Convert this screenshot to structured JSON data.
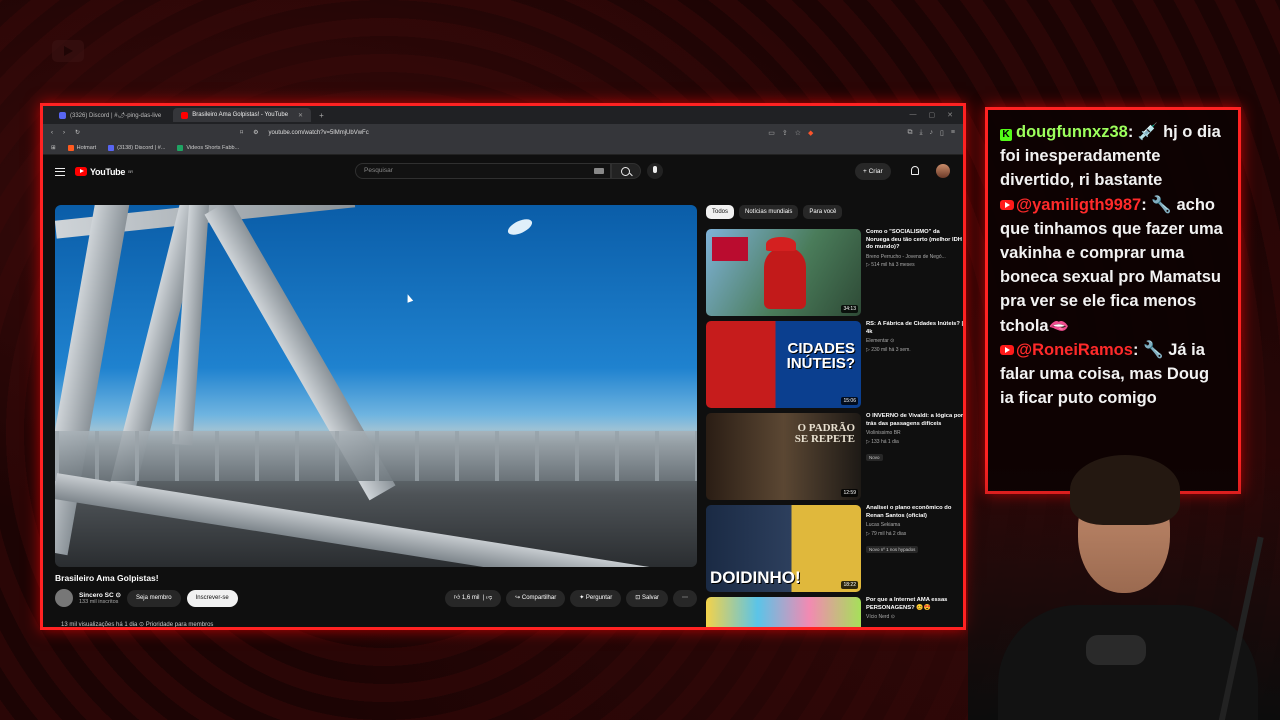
{
  "browser": {
    "tabs": [
      {
        "label": "(3326) Discord | #🌶-ping-das-live"
      },
      {
        "label": "Brasileiro Ama Golpistas! - YouTube"
      }
    ],
    "url": "youtube.com/watch?v=5lMmjUbVwFc",
    "bookmarks": [
      {
        "label": "Hotmart",
        "color": "#ff5a1f"
      },
      {
        "label": "(3138) Discord | #...",
        "color": "#5865f2"
      },
      {
        "label": "Videos Shorts Fabb...",
        "color": "#1fa463"
      }
    ]
  },
  "youtube": {
    "logo": "YouTube",
    "logo_country": "BR",
    "search_placeholder": "Pesquisar",
    "create_label": "+ Criar",
    "video": {
      "title": "Brasileiro Ama Golpistas!",
      "channel": "Sincero SC",
      "subscribers": "133 mil inscritos",
      "join_label": "Seja membro",
      "subscribe_label": "Inscrever-se",
      "likes": "1,6 mil",
      "share_label": "Compartilhar",
      "ask_label": "Perguntar",
      "save_label": "Salvar",
      "views_line": "13 mil visualizações  há 1 dia  ⊙ Prioridade para membros"
    },
    "chips": [
      "Todos",
      "Notícias mundiais",
      "Para você"
    ],
    "recommendations": [
      {
        "title": "Como o \"SOCIALISMO\" da Noruega deu tão certo (melhor IDH do mundo)?",
        "channel": "Breno Perrucho - Jovens de Negó...",
        "meta": "▷ 514 mil  há 3 meses",
        "duration": "34:13",
        "thumb_text": "",
        "badge": ""
      },
      {
        "title": "RS: A Fábrica de Cidades Inúteis? | 4k",
        "channel": "Elementar ⊙",
        "meta": "▷ 230 mil  há 3 sem.",
        "duration": "15:06",
        "thumb_text": "CIDADES INÚTEIS?",
        "badge": ""
      },
      {
        "title": "O INVERNO de Vivaldi: a lógica por trás das passagens difíceis",
        "channel": "Violinissimo BR",
        "meta": "▷ 133  há 1 dia",
        "duration": "12:59",
        "thumb_text": "O PADRÃO SE REPETE",
        "badge": "Novo"
      },
      {
        "title": "Analisei o plano econômico do Renan Santos (oficial)",
        "channel": "Lucas Sekiama",
        "meta": "▷ 79 mil  há 2 dias",
        "duration": "18:22",
        "thumb_text": "DOIDINHO!",
        "badge": "Novo  nº 1 nos hypados"
      },
      {
        "title": "Por que a Internet AMA essas PERSONAGENS? 😊😍",
        "channel": "Vício Nerd ⊙",
        "meta": "",
        "duration": "",
        "thumb_text": "",
        "badge": ""
      }
    ]
  },
  "chat": {
    "messages": [
      {
        "user": "dougfunnxz38",
        "platform": "kick",
        "badge": "💉",
        "text": "hj o dia foi inesperadamente divertido, ri bastante"
      },
      {
        "user": "@yamiligth9987",
        "platform": "youtube",
        "badge": "🔧",
        "text": "acho que tinhamos que fazer uma vakinha e comprar uma boneca sexual pro Mamatsu pra ver se ele fica menos tchola🫦"
      },
      {
        "user": "@RoneiRamos",
        "platform": "youtube",
        "badge": "🔧",
        "text": "Já ia falar uma coisa, mas Doug ia ficar puto comigo"
      }
    ]
  },
  "colors": {
    "accent": "#ff2222",
    "yt_red": "#ff0000",
    "kick_green": "#53fc18"
  }
}
